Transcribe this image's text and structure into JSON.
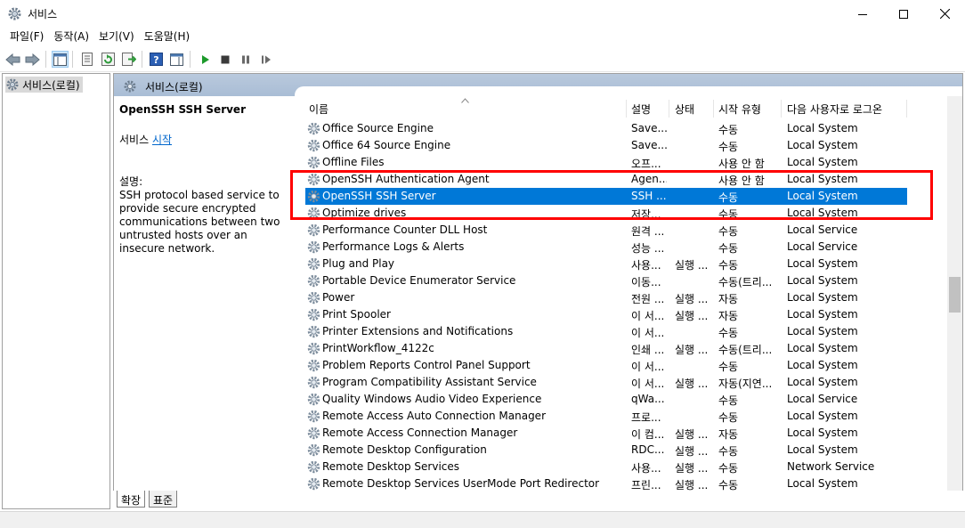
{
  "window": {
    "title": "서비스",
    "controls": [
      "minimize",
      "maximize",
      "close"
    ]
  },
  "menu": {
    "items": [
      "파일(F)",
      "동작(A)",
      "보기(V)",
      "도움말(H)"
    ]
  },
  "toolbar": {
    "icons": [
      "back-icon",
      "forward-icon",
      "show-hide-tree-icon",
      "properties-icon",
      "refresh-icon",
      "export-list-icon",
      "help-icon",
      "show-hide-action-pane-icon",
      "start-service-icon",
      "stop-service-icon",
      "pause-service-icon",
      "restart-service-icon"
    ]
  },
  "tree": {
    "root_label": "서비스(로컬)"
  },
  "panel": {
    "header": "서비스(로컬)",
    "selected_name": "OpenSSH SSH Server",
    "start_prefix": "서비스 ",
    "start_link": "시작",
    "desc_label": "설명:",
    "desc_text": "SSH protocol based service to provide secure encrypted communications between two untrusted hosts over an insecure network."
  },
  "columns": {
    "name": "이름",
    "description": "설명",
    "status": "상태",
    "startup": "시작 유형",
    "logon": "다음 사용자로 로그온"
  },
  "services": [
    {
      "name": "Office  Source Engine",
      "desc": "Save...",
      "status": "",
      "startup": "수동",
      "logon": "Local System"
    },
    {
      "name": "Office 64 Source Engine",
      "desc": "Save...",
      "status": "",
      "startup": "수동",
      "logon": "Local System"
    },
    {
      "name": "Offline Files",
      "desc": "오프...",
      "status": "",
      "startup": "사용 안 함",
      "logon": "Local System"
    },
    {
      "name": "OpenSSH Authentication Agent",
      "desc": "Agen...",
      "status": "",
      "startup": "사용 안 함",
      "logon": "Local System"
    },
    {
      "name": "OpenSSH SSH Server",
      "desc": "SSH ...",
      "status": "",
      "startup": "수동",
      "logon": "Local System",
      "selected": true
    },
    {
      "name": "Optimize drives",
      "desc": "저장...",
      "status": "",
      "startup": "수동",
      "logon": "Local System"
    },
    {
      "name": "Performance Counter DLL Host",
      "desc": "원격 ...",
      "status": "",
      "startup": "수동",
      "logon": "Local Service"
    },
    {
      "name": "Performance Logs & Alerts",
      "desc": "성능 ...",
      "status": "",
      "startup": "수동",
      "logon": "Local Service"
    },
    {
      "name": "Plug and Play",
      "desc": "사용...",
      "status": "실행 ...",
      "startup": "수동",
      "logon": "Local System"
    },
    {
      "name": "Portable Device Enumerator Service",
      "desc": "이동...",
      "status": "",
      "startup": "수동(트리...",
      "logon": "Local System"
    },
    {
      "name": "Power",
      "desc": "전원 ...",
      "status": "실행 ...",
      "startup": "자동",
      "logon": "Local System"
    },
    {
      "name": "Print Spooler",
      "desc": "이 서...",
      "status": "실행 ...",
      "startup": "자동",
      "logon": "Local System"
    },
    {
      "name": "Printer Extensions and Notifications",
      "desc": "이 서...",
      "status": "",
      "startup": "수동",
      "logon": "Local System"
    },
    {
      "name": "PrintWorkflow_4122c",
      "desc": "인쇄 ...",
      "status": "실행 ...",
      "startup": "수동(트리...",
      "logon": "Local System"
    },
    {
      "name": "Problem Reports Control Panel Support",
      "desc": "이 서...",
      "status": "",
      "startup": "수동",
      "logon": "Local System"
    },
    {
      "name": "Program Compatibility Assistant Service",
      "desc": "이 서...",
      "status": "실행 ...",
      "startup": "자동(지연...",
      "logon": "Local System"
    },
    {
      "name": "Quality Windows Audio Video Experience",
      "desc": "qWa...",
      "status": "",
      "startup": "수동",
      "logon": "Local Service"
    },
    {
      "name": "Remote Access Auto Connection Manager",
      "desc": "프로...",
      "status": "",
      "startup": "수동",
      "logon": "Local System"
    },
    {
      "name": "Remote Access Connection Manager",
      "desc": "이 컴...",
      "status": "실행 ...",
      "startup": "자동",
      "logon": "Local System"
    },
    {
      "name": "Remote Desktop Configuration",
      "desc": "RDC...",
      "status": "실행 ...",
      "startup": "수동",
      "logon": "Local System"
    },
    {
      "name": "Remote Desktop Services",
      "desc": "사용...",
      "status": "실행 ...",
      "startup": "수동",
      "logon": "Network Service"
    },
    {
      "name": "Remote Desktop Services UserMode Port Redirector",
      "desc": "프린...",
      "status": "실행 ...",
      "startup": "수동",
      "logon": "Local System"
    }
  ],
  "tabs": [
    "확장",
    "표준"
  ],
  "colors": {
    "selection": "#0078d7",
    "highlight_box": "#ff0000",
    "link": "#0066cc",
    "panel_header": "#b9c9dd"
  }
}
